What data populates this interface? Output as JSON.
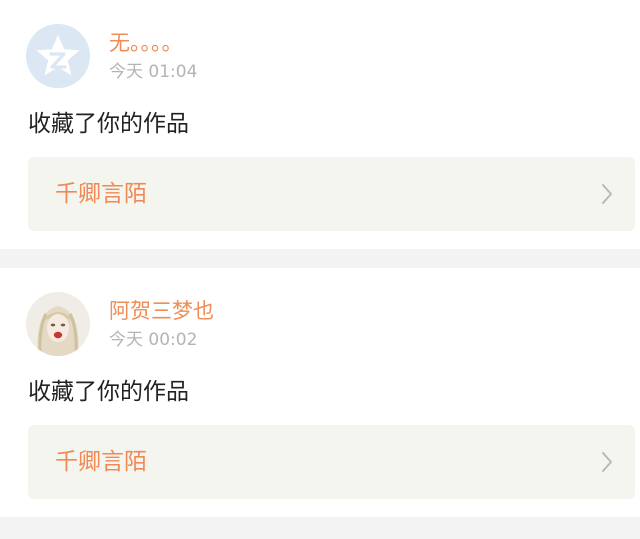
{
  "notifications": [
    {
      "user_name": "无。。。。",
      "timestamp": "今天 01:04",
      "action": "收藏了你的作品",
      "work_title": "千卿言陌",
      "avatar_icon": "default-qzone-avatar-icon"
    },
    {
      "user_name": "阿贺三梦也",
      "timestamp": "今天 00:02",
      "action": "收藏了你的作品",
      "work_title": "千卿言陌",
      "avatar_icon": "user-photo-avatar"
    }
  ],
  "colors": {
    "accent": "#f08c55",
    "timestamp": "#b4b4b4",
    "card_background": "#f5f5ef",
    "page_background": "#f3f3f3"
  }
}
